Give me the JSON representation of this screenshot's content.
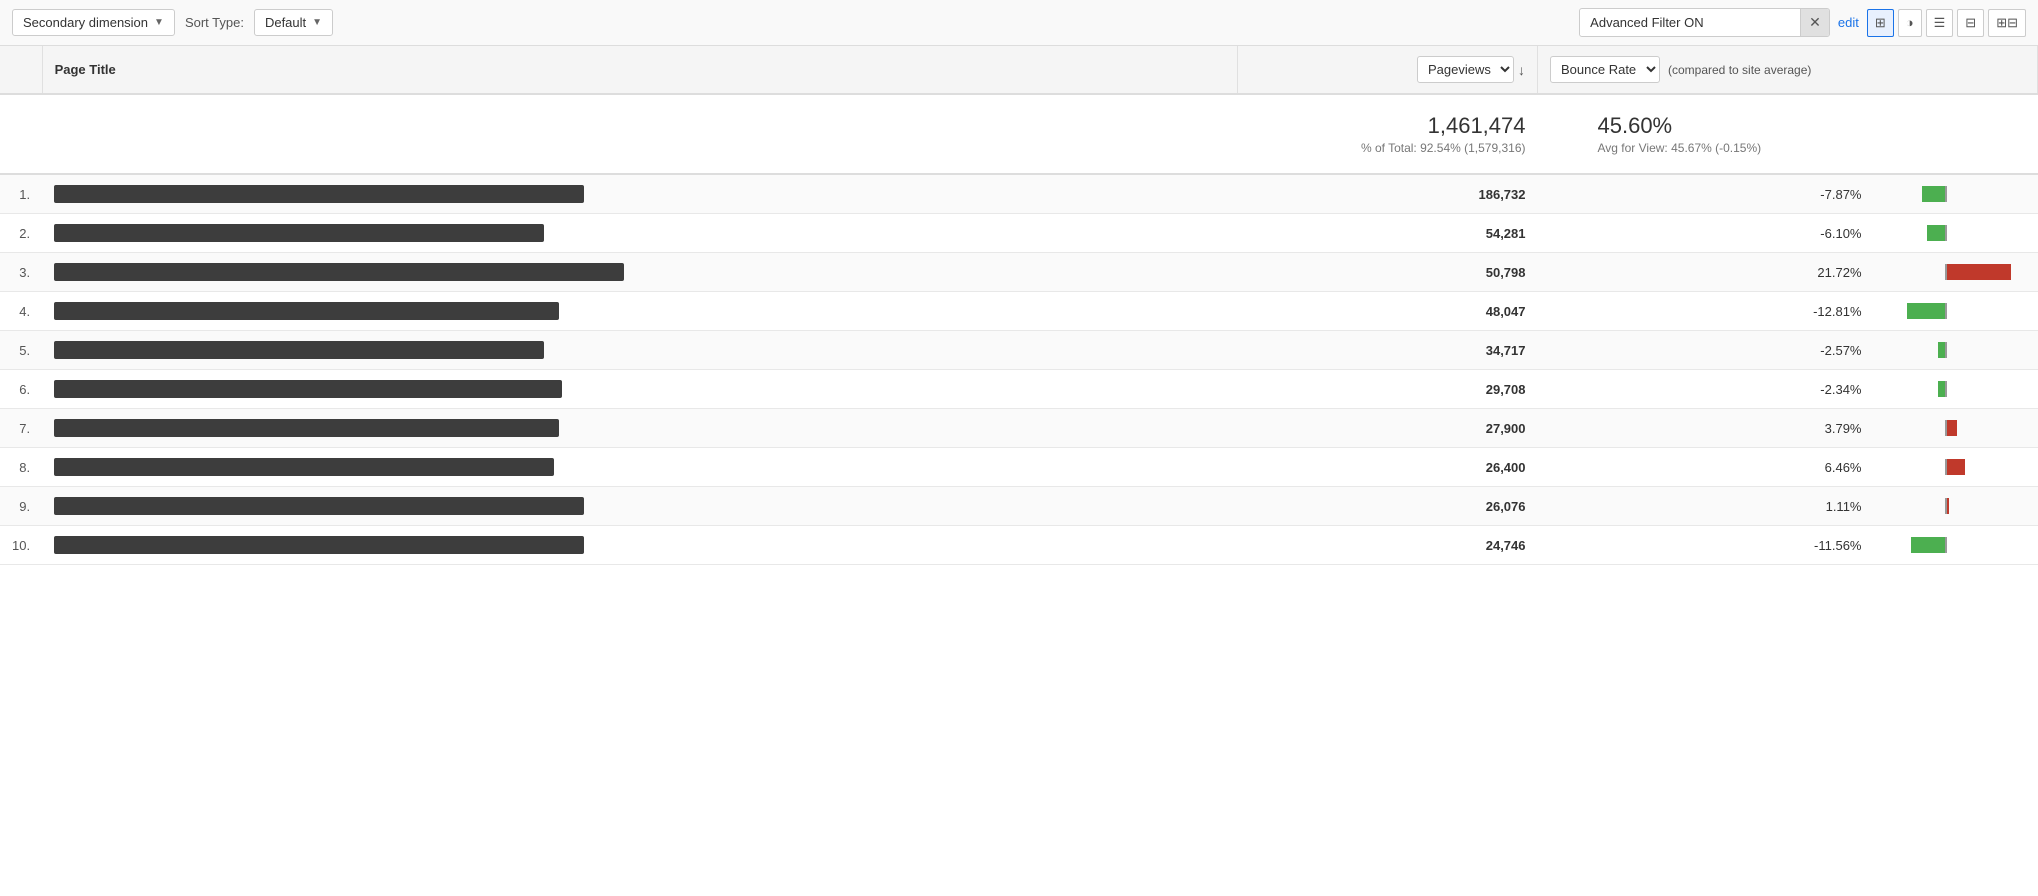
{
  "toolbar": {
    "secondary_dimension_label": "Secondary dimension",
    "sort_type_label": "Sort Type:",
    "sort_default": "Default",
    "filter_value": "Advanced Filter ON",
    "close_icon": "✕",
    "edit_label": "edit",
    "view_icons": [
      "⊞",
      "◑",
      "☰",
      "⊟",
      "⊞⊞"
    ]
  },
  "table": {
    "col_page_title": "Page Title",
    "col_pageviews": "Pageviews",
    "col_bounce_rate": "Bounce Rate",
    "col_compared": "(compared to site average)",
    "sort_arrow": "↓",
    "summary": {
      "pageviews": "1,461,474",
      "pageviews_pct": "% of Total: 92.54% (1,579,316)",
      "bounce_rate": "45.60%",
      "bounce_avg": "Avg for View: 45.67% (-0.15%)"
    },
    "rows": [
      {
        "num": "1.",
        "title_width": 530,
        "pageviews": "186,732",
        "bounce_pct": "-7.87%",
        "bounce_type": "green",
        "bounce_bar_pct": 7.87
      },
      {
        "num": "2.",
        "title_width": 490,
        "pageviews": "54,281",
        "bounce_pct": "-6.10%",
        "bounce_type": "green",
        "bounce_bar_pct": 6.1
      },
      {
        "num": "3.",
        "title_width": 570,
        "pageviews": "50,798",
        "bounce_pct": "21.72%",
        "bounce_type": "red",
        "bounce_bar_pct": 21.72
      },
      {
        "num": "4.",
        "title_width": 505,
        "pageviews": "48,047",
        "bounce_pct": "-12.81%",
        "bounce_type": "green",
        "bounce_bar_pct": 12.81
      },
      {
        "num": "5.",
        "title_width": 490,
        "pageviews": "34,717",
        "bounce_pct": "-2.57%",
        "bounce_type": "green",
        "bounce_bar_pct": 2.57
      },
      {
        "num": "6.",
        "title_width": 508,
        "pageviews": "29,708",
        "bounce_pct": "-2.34%",
        "bounce_type": "green",
        "bounce_bar_pct": 2.34
      },
      {
        "num": "7.",
        "title_width": 505,
        "pageviews": "27,900",
        "bounce_pct": "3.79%",
        "bounce_type": "red",
        "bounce_bar_pct": 3.79
      },
      {
        "num": "8.",
        "title_width": 500,
        "pageviews": "26,400",
        "bounce_pct": "6.46%",
        "bounce_type": "red",
        "bounce_bar_pct": 6.46
      },
      {
        "num": "9.",
        "title_width": 530,
        "pageviews": "26,076",
        "bounce_pct": "1.11%",
        "bounce_type": "red",
        "bounce_bar_pct": 1.11
      },
      {
        "num": "10.",
        "title_width": 530,
        "pageviews": "24,746",
        "bounce_pct": "-11.56%",
        "bounce_type": "green",
        "bounce_bar_pct": 11.56
      }
    ]
  },
  "colors": {
    "green_bar": "#4caf50",
    "red_bar": "#c0392b",
    "title_bar": "#3d3d3d"
  }
}
